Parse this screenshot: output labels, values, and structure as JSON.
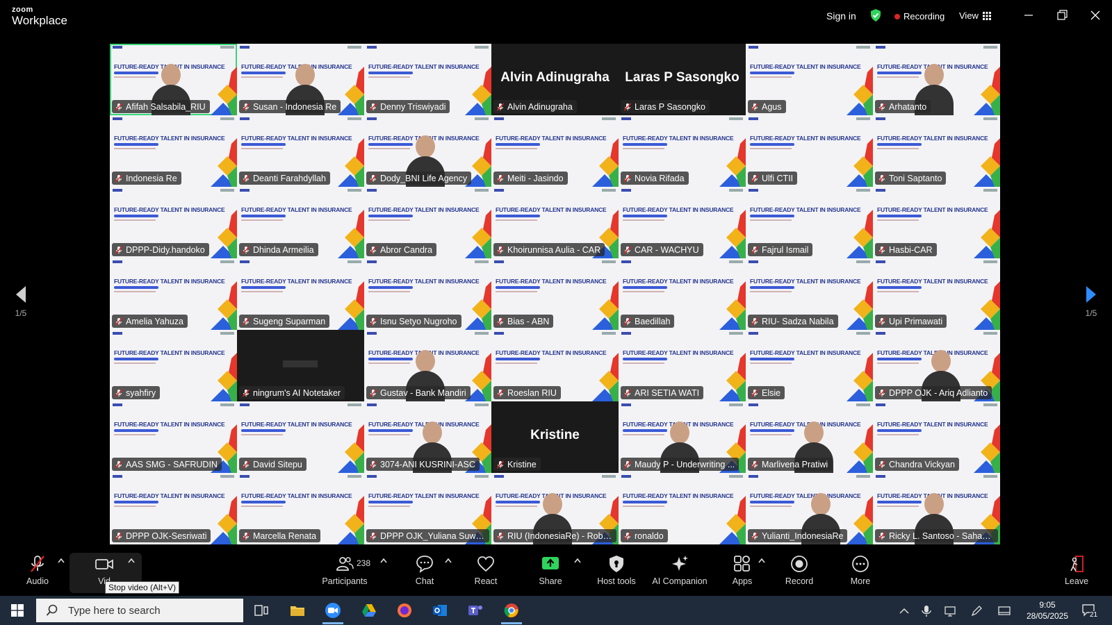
{
  "app": {
    "brand_top": "zoom",
    "brand_bottom": "Workplace",
    "sign_in": "Sign in",
    "recording": "Recording",
    "view": "View"
  },
  "slide": {
    "title": "FUTURE-READY TALENT IN INSURANCE"
  },
  "pager": {
    "left": "1/5",
    "right": "1/5"
  },
  "participants": [
    {
      "name": "Afifah Salsabila_RIU",
      "kind": "video",
      "active": true
    },
    {
      "name": "Susan - Indonesia Re",
      "kind": "video"
    },
    {
      "name": "Denny Triswiyadi",
      "kind": "slide"
    },
    {
      "name": "Alvin Adinugraha",
      "kind": "name",
      "big": "Alvin Adinugraha"
    },
    {
      "name": "Laras P Sasongko",
      "kind": "name",
      "big": "Laras P Sasongko"
    },
    {
      "name": "Agus",
      "kind": "slide"
    },
    {
      "name": "Arhatanto",
      "kind": "video"
    },
    {
      "name": "Indonesia Re",
      "kind": "slide"
    },
    {
      "name": "Deanti Farahdyllah",
      "kind": "slide"
    },
    {
      "name": "Dody_BNI Life Agency",
      "kind": "video"
    },
    {
      "name": "Meiti - Jasindo",
      "kind": "slide"
    },
    {
      "name": "Novia Rifada",
      "kind": "slide"
    },
    {
      "name": "Ulfi CTII",
      "kind": "slide"
    },
    {
      "name": "Toni Saptanto",
      "kind": "slide"
    },
    {
      "name": "DPPP-Didy.handoko",
      "kind": "slide"
    },
    {
      "name": "Dhinda Armeilia",
      "kind": "slide"
    },
    {
      "name": "Abror Candra",
      "kind": "slide"
    },
    {
      "name": "Khoirunnisa Aulia - CAR",
      "kind": "slide"
    },
    {
      "name": "CAR - WACHYU",
      "kind": "slide"
    },
    {
      "name": "Fajrul Ismail",
      "kind": "slide"
    },
    {
      "name": "Hasbi-CAR",
      "kind": "slide"
    },
    {
      "name": "Amelia Yahuza",
      "kind": "slide"
    },
    {
      "name": "Sugeng Suparman",
      "kind": "slide"
    },
    {
      "name": "Isnu Setyo Nugroho",
      "kind": "slide"
    },
    {
      "name": "Bias - ABN",
      "kind": "slide"
    },
    {
      "name": "Baedillah",
      "kind": "slide"
    },
    {
      "name": "RIU- Sadza Nabila",
      "kind": "slide"
    },
    {
      "name": "Upi Primawati",
      "kind": "slide"
    },
    {
      "name": "syahfiry",
      "kind": "slide"
    },
    {
      "name": "ningrum's AI Notetaker",
      "kind": "notetaker"
    },
    {
      "name": "Gustav - Bank Mandiri",
      "kind": "video"
    },
    {
      "name": "Roeslan RIU",
      "kind": "slide"
    },
    {
      "name": "ARI SETIA WATI",
      "kind": "slide"
    },
    {
      "name": "Elsie",
      "kind": "slide"
    },
    {
      "name": "DPPP OJK - Ariq Adlianto",
      "kind": "video"
    },
    {
      "name": "AAS SMG - SAFRUDIN",
      "kind": "slide"
    },
    {
      "name": "David Sitepu",
      "kind": "slide"
    },
    {
      "name": "3074-ANI KUSRINI-ASC",
      "kind": "video"
    },
    {
      "name": "Kristine",
      "kind": "name",
      "big": "Kristine"
    },
    {
      "name": "Maudy P - Underwriting ...",
      "kind": "video"
    },
    {
      "name": "Marlivena Pratiwi",
      "kind": "video"
    },
    {
      "name": "Chandra Vickyan",
      "kind": "slide"
    },
    {
      "name": "DPPP OJK-Sesriwati",
      "kind": "slide"
    },
    {
      "name": "Marcella Renata",
      "kind": "slide"
    },
    {
      "name": "DPPP OJK_Yuliana Suwanto",
      "kind": "slide"
    },
    {
      "name": "RIU (IndonesiaRe) - Robbi Wa...",
      "kind": "video"
    },
    {
      "name": "ronaldo",
      "kind": "slide"
    },
    {
      "name": "Yulianti_IndonesiaRe",
      "kind": "video"
    },
    {
      "name": "Ricky L. Santoso - Sahaba...",
      "kind": "video"
    }
  ],
  "toolbar": {
    "audio": "Audio",
    "video": "Vid",
    "tooltip": "Stop video (Alt+V)",
    "participants": "Participants",
    "participants_count": "238",
    "chat": "Chat",
    "react": "React",
    "share": "Share",
    "host_tools": "Host tools",
    "ai_companion": "AI Companion",
    "apps": "Apps",
    "record": "Record",
    "more": "More",
    "leave": "Leave"
  },
  "taskbar": {
    "search_placeholder": "Type here to search",
    "time": "9:05",
    "date": "28/05/2025",
    "notifications": "21"
  },
  "colors": {
    "active_speaker": "#3ad67a",
    "share_green": "#2fd45c",
    "recording_red": "#e02424",
    "slide_title": "#24358f"
  }
}
